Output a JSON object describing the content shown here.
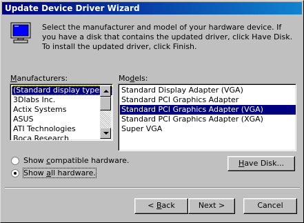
{
  "window": {
    "title": "Update Device Driver Wizard"
  },
  "instruction": "Select the manufacturer and model of your hardware device. If you have a disk that contains the updated driver, click Have Disk. To install the updated driver, click Finish.",
  "manufacturers": {
    "label_u": "M",
    "label_rest": "anufacturers:",
    "items": [
      "(Standard display types)",
      "3Dlabs Inc.",
      "Actix Systems",
      "ASUS",
      "ATI Technologies",
      "Boca Research"
    ],
    "selected_index": 0
  },
  "models": {
    "label_pre": "Mo",
    "label_u": "d",
    "label_post": "els:",
    "items": [
      "Standard Display Adapter (VGA)",
      "Standard PCI Graphics Adapter",
      "Standard PCI Graphics Adapter (VGA)",
      "Standard PCI Graphics Adapter (XGA)",
      "Super VGA"
    ],
    "selected_index": 2
  },
  "options": {
    "compatible": {
      "pre": "Show ",
      "u": "c",
      "post": "ompatible hardware.",
      "checked": false
    },
    "all": {
      "pre": "Show ",
      "u": "a",
      "post": "ll hardware.",
      "checked": true
    }
  },
  "buttons": {
    "have_disk": {
      "u": "H",
      "post": "ave Disk..."
    },
    "back": {
      "pre": "< ",
      "u": "B",
      "post": "ack"
    },
    "next": "Next >",
    "cancel": "Cancel"
  }
}
